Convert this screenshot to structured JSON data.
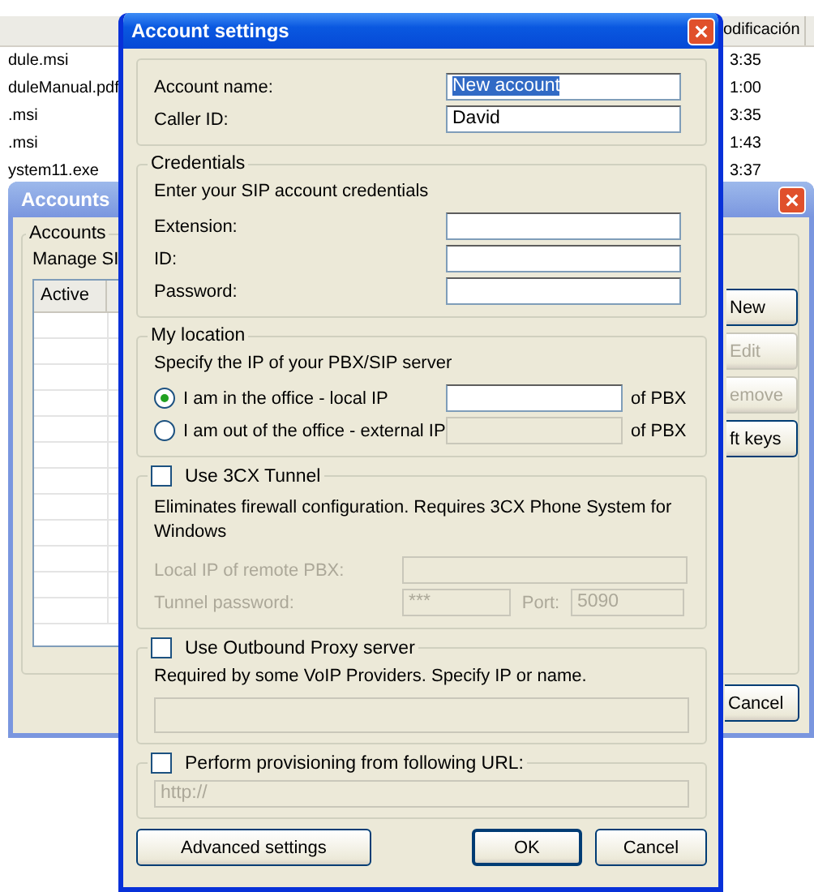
{
  "file_list": {
    "columns": [
      "odificación"
    ],
    "rows": [
      {
        "name": "dule.msi",
        "time": "3:35"
      },
      {
        "name": "duleManual.pdf",
        "time": "1:00"
      },
      {
        "name": ".msi",
        "time": "3:35"
      },
      {
        "name": ".msi",
        "time": "1:43"
      },
      {
        "name": "ystem11.exe",
        "time": "3:37"
      }
    ]
  },
  "accounts_window": {
    "title": "Accounts",
    "group_label": "Accounts",
    "description": "Manage SI",
    "table": {
      "columns": [
        "Active"
      ]
    },
    "buttons": [
      {
        "label": "New",
        "disabled": false
      },
      {
        "label": "Edit",
        "disabled": true
      },
      {
        "label": "emove",
        "disabled": true
      },
      {
        "label": "ft keys",
        "disabled": false
      }
    ],
    "cancel_button": "Cancel"
  },
  "dialog": {
    "title": "Account settings",
    "identity_fields": [
      {
        "label": "Account name:",
        "value": "New account",
        "value_selected": true
      },
      {
        "label": "Caller ID:",
        "value": "David",
        "value_selected": false
      }
    ],
    "credentials": {
      "title": "Credentials",
      "hint": "Enter your SIP account credentials",
      "fields": [
        {
          "label": "Extension:"
        },
        {
          "label": "ID:"
        },
        {
          "label": "Password:"
        }
      ]
    },
    "location": {
      "title": "My location",
      "hint": "Specify the IP of your PBX/SIP server",
      "options": [
        {
          "label": "I am in the office - local IP",
          "selected": true,
          "suffix": "of PBX"
        },
        {
          "label": "I am out of the office - external IP",
          "selected": false,
          "suffix": "of PBX"
        }
      ]
    },
    "tunnel": {
      "label": "Use 3CX Tunnel",
      "checked": false,
      "hint": "Eliminates firewall configuration. Requires 3CX Phone System for Windows",
      "remote_ip_label": "Local IP of remote PBX:",
      "password_label": "Tunnel password:",
      "password_value": "***",
      "port_label": "Port:",
      "port_value": "5090"
    },
    "proxy": {
      "label": "Use Outbound Proxy server",
      "checked": false,
      "hint": "Required by some VoIP Providers. Specify IP or name."
    },
    "provisioning": {
      "label": "Perform provisioning from following URL:",
      "checked": false,
      "url_value": "http://"
    },
    "buttons": [
      {
        "label": "Advanced settings",
        "kind": "extra"
      },
      {
        "label": "OK",
        "kind": "default"
      },
      {
        "label": "Cancel",
        "kind": "cancel"
      }
    ]
  }
}
